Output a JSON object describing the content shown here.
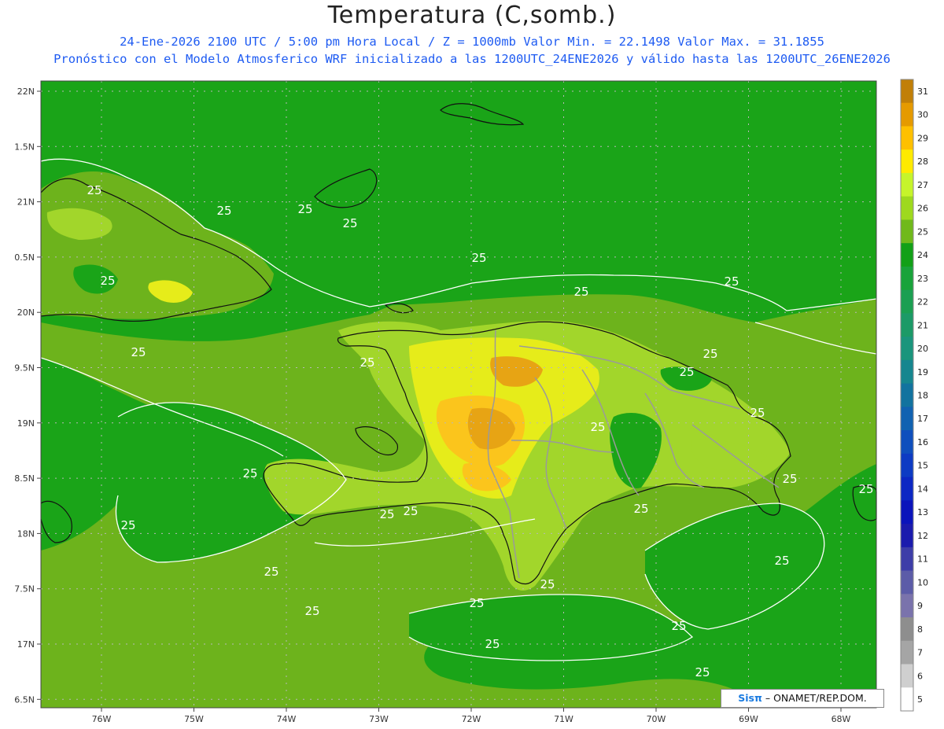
{
  "title": "Temperatura (C,somb.)",
  "subtitle_line1": "24-Ene-2026  2100 UTC / 5:00 pm Hora Local / Z = 1000mb   Valor Min. = 22.1498  Valor Max. = 31.1855",
  "subtitle_line2": "Pronóstico con el Modelo Atmosferico WRF inicializado a las 1200UTC_24ENE2026 y válido hasta las  1200UTC_26ENE2026",
  "credit": {
    "brand": "Sisπ",
    "text": " – ONAMET/REP.DOM."
  },
  "colors": {
    "ocean": "#1aa418",
    "warm26": "#6db31c",
    "warm27": "#a2d62b",
    "warm28": "#e6ec1a",
    "warm29": "#fbc51c",
    "warm30": "#e7a414",
    "warm31": "#c38410",
    "isoline": "#ffffff",
    "coast": "#111111",
    "borders": "#9a9a9a"
  },
  "map": {
    "lon_range": [
      -76.65,
      -67.6
    ],
    "lat_range": [
      16.45,
      22.1
    ],
    "lon_ticks": [
      "76W",
      "75W",
      "74W",
      "73W",
      "72W",
      "71W",
      "70W",
      "69W",
      "68W"
    ],
    "lat_ticks": [
      "22N",
      "1.5N",
      "21N",
      "0.5N",
      "20N",
      "9.5N",
      "19N",
      "8.5N",
      "18N",
      "7.5N",
      "17N",
      "6.5N"
    ],
    "contour_label": "25"
  },
  "colorbar": {
    "labels": [
      "31",
      "30",
      "29",
      "28",
      "27",
      "26",
      "25",
      "24",
      "23",
      "22",
      "21",
      "20",
      "19",
      "18",
      "17",
      "16",
      "15",
      "14",
      "13",
      "12",
      "11",
      "10",
      "9",
      "8",
      "7",
      "6",
      "5"
    ],
    "colors": [
      "#c17f08",
      "#e59a00",
      "#ffc000",
      "#ffea00",
      "#c6f42b",
      "#9ed91e",
      "#70b91b",
      "#12a017",
      "#19a33a",
      "#1b9f52",
      "#1c9a67",
      "#1a957c",
      "#16868f",
      "#12739f",
      "#1162b1",
      "#0f4fbd",
      "#0d3bc3",
      "#0c27c3",
      "#0b14bb",
      "#1b1bad",
      "#3d3da8",
      "#5c5ca8",
      "#7a73ac",
      "#8e8e8e",
      "#a5a5a5",
      "#cfcfcf",
      "#ffffff"
    ]
  }
}
